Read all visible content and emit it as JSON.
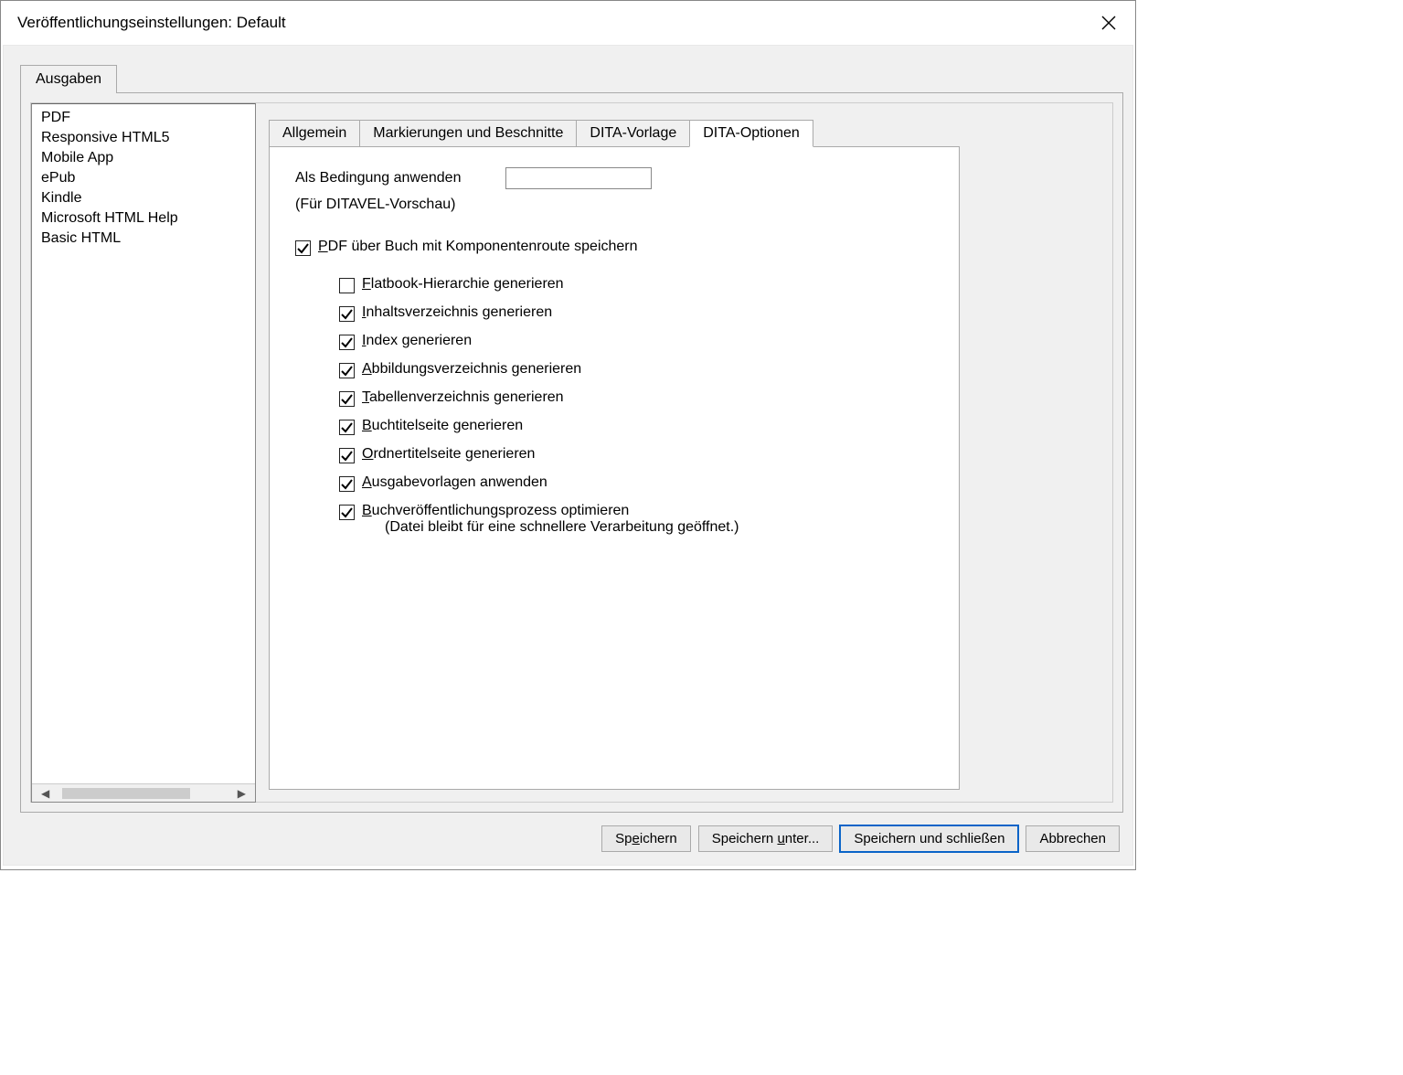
{
  "window": {
    "title": "Veröffentlichungseinstellungen: Default"
  },
  "outerTab": "Ausgaben",
  "formats": {
    "items": [
      {
        "label": "PDF"
      },
      {
        "label": "Responsive HTML5"
      },
      {
        "label": "Mobile App"
      },
      {
        "label": "ePub"
      },
      {
        "label": "Kindle"
      },
      {
        "label": "Microsoft HTML Help"
      },
      {
        "label": "Basic HTML"
      }
    ]
  },
  "innerTabs": [
    {
      "label": "Allgemein"
    },
    {
      "label": "Markierungen und Beschnitte"
    },
    {
      "label": "DITA-Vorlage"
    },
    {
      "label": "DITA-Optionen"
    }
  ],
  "panel": {
    "applyConditionLabel": "Als Bedingung anwenden",
    "applyConditionValue": "",
    "ditavalNote": "(Für DITAVEL-Vorschau)",
    "pdfBookAccess": "P",
    "pdfBookRest": "DF über Buch mit Komponentenroute speichern",
    "opts": [
      {
        "access": "F",
        "rest": "latbook-Hierarchie generieren",
        "checked": false
      },
      {
        "access": "I",
        "rest": "nhaltsverzeichnis generieren",
        "checked": true
      },
      {
        "access": "I",
        "rest": "ndex generieren",
        "checked": true
      },
      {
        "access": "A",
        "rest": "bbildungsverzeichnis generieren",
        "checked": true
      },
      {
        "access": "T",
        "rest": "abellenverzeichnis generieren",
        "checked": true
      },
      {
        "access": "B",
        "rest": "uchtitelseite generieren",
        "checked": true
      },
      {
        "access": "O",
        "rest": "rdnertitelseite generieren",
        "checked": true
      },
      {
        "access": "A",
        "rest": "usgabevorlagen anwenden",
        "checked": true
      },
      {
        "access": "B",
        "rest": "uchveröffentlichungsprozess optimieren",
        "checked": true,
        "sub": "(Datei bleibt für eine schnellere Verarbeitung geöffnet.)"
      }
    ]
  },
  "buttons": {
    "save": "Speichern",
    "save_u": "e",
    "saveAs": "Speichern unter...",
    "saveAs_u": "u",
    "saveClose": "Speichern und schließen",
    "cancel": "Abbrechen"
  }
}
